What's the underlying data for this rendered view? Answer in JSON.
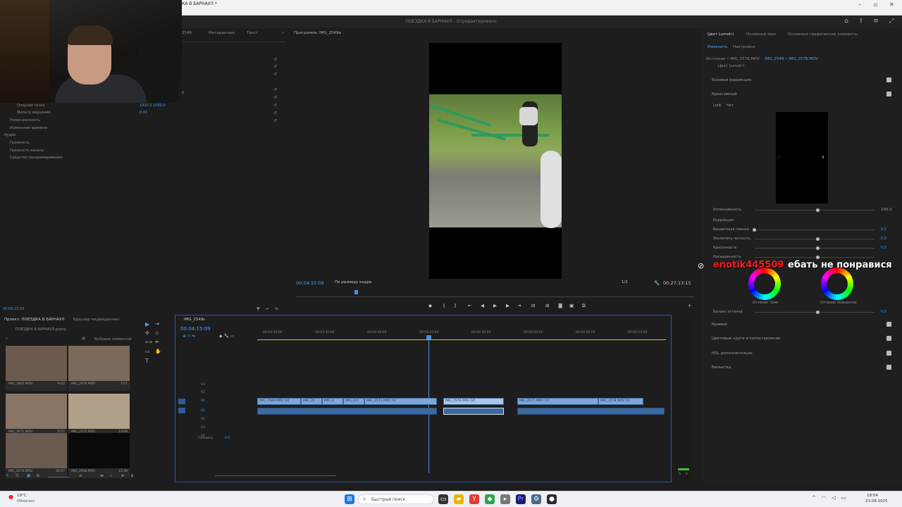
{
  "window": {
    "title": "КА В БАРНАУЛ *",
    "minimize": "–",
    "maximize": "▫",
    "close": "✕"
  },
  "app": {
    "project_title": "ПОЕЗДКА В БАРНАУЛ",
    "status": "- Отредактировано"
  },
  "effects_panel": {
    "tabs": [
      "2549",
      "Метаданные",
      "Текст"
    ],
    "rows": [
      {
        "label": "Опорная точка",
        "value": "1920.0    1080.0"
      },
      {
        "label": "Фильтр мерцаний",
        "value": "0.00"
      },
      {
        "label": "Непрозрачность",
        "value": ""
      },
      {
        "label": "Изменение времени",
        "value": ""
      },
      {
        "label": "Аудио",
        "value": ""
      },
      {
        "label": "Громкость",
        "value": ""
      },
      {
        "label": "Громкость канала",
        "value": ""
      },
      {
        "label": "Средство панорамирования",
        "value": ""
      }
    ],
    "small_val": "6",
    "timecode": "00:04:15:09"
  },
  "program_monitor": {
    "title": "Программа: IMG_2549",
    "timecode": "00:04:15:09",
    "fit": "По размеру кадра",
    "ratio": "1/2",
    "duration": "00:27:13:15"
  },
  "project_panel": {
    "tabs": [
      "Проект: ПОЕЗДКА В БАРНАУЛ",
      "Браузер медиаданных"
    ],
    "path": "ПОЕЗДКА В БАРНАУЛ.prproj",
    "selected": "Выбрано элементов",
    "thumbs": [
      {
        "name": "IMG_2665.MOV",
        "dur": "9:42"
      },
      {
        "name": "IMG_2670.MOV",
        "dur": "3:57"
      },
      {
        "name": "IMG_2671.MOV",
        "dur": "6:57"
      },
      {
        "name": "IMG_2672.MOV",
        "dur": "13:09"
      },
      {
        "name": "IMG_2674.MOV",
        "dur": "28:07"
      },
      {
        "name": "IMG_2698.MOV",
        "dur": "15:39"
      }
    ]
  },
  "timeline": {
    "tab": "IMG_2549",
    "timecode": "00:04:15:09",
    "ruler": [
      "00:03:30:00",
      "00:03:45:00",
      "00:04:00:00",
      "00:04:15:00",
      "00:04:30:00",
      "00:04:45:00",
      "00:05:00:00",
      "00:05:15:00"
    ],
    "tracks_v": [
      "V3",
      "V2",
      "V1"
    ],
    "tracks_a": [
      "A1",
      "A2",
      "A3",
      "A4"
    ],
    "mix_label": "Смешать",
    "mix_value": "0.0",
    "clips": [
      "IMG_2569.MOV [V]",
      "IMG_25",
      "IMG_2",
      "IMG_257",
      "IMG_2573.MOV [V]",
      "IMG_2576.MOV [V]",
      "IMG_2577.MOV [V]",
      "IMG_2578.MOV [V]"
    ],
    "meter_labels": [
      "S",
      "S"
    ]
  },
  "lumetri": {
    "tabs": [
      "Цвет Lumetri",
      "Основной звук",
      "Основные графические элементы"
    ],
    "subtabs": [
      "Изменить",
      "Настройки"
    ],
    "source": "Источник • IMG_2576.MOV",
    "target": "IMG_2549 • IMG_2576.MOV",
    "effect": "Цвет Lumetri",
    "sections": {
      "basic": "Базовая коррекция",
      "creative": "Креативный",
      "look_label": "Look",
      "look_value": "Нет",
      "intensity": "Интенсивность",
      "intensity_val": "100.0",
      "correction": "Коррекция",
      "faded": "Выцветшая пленка",
      "sharpen": "Увеличить четкость",
      "vibrance": "Красочность",
      "saturation": "Насыщенность",
      "zero": "0.0",
      "shadow_tint": "Оттенок тени",
      "highlight_tint": "Оттенок подсветки",
      "tint_balance": "Баланс оттенка",
      "curves": "Кривые",
      "color_wheels": "Цветовые круги и сопоставление",
      "hsl": "HSL дополнительно",
      "vignette": "Виньетка"
    }
  },
  "overlay": {
    "user": "enotik445509",
    "message": "ебать не понравися"
  },
  "taskbar": {
    "weather_temp": "19°C",
    "weather_desc": "Облачно",
    "search": "Быстрый поиск",
    "time": "18:54",
    "date": "23.08.2025"
  },
  "colors": {
    "accent": "#4aa3ff",
    "clip": "#7da7d9",
    "playhead": "#4a8fe0",
    "overlay_red": "#ff1a1a"
  }
}
